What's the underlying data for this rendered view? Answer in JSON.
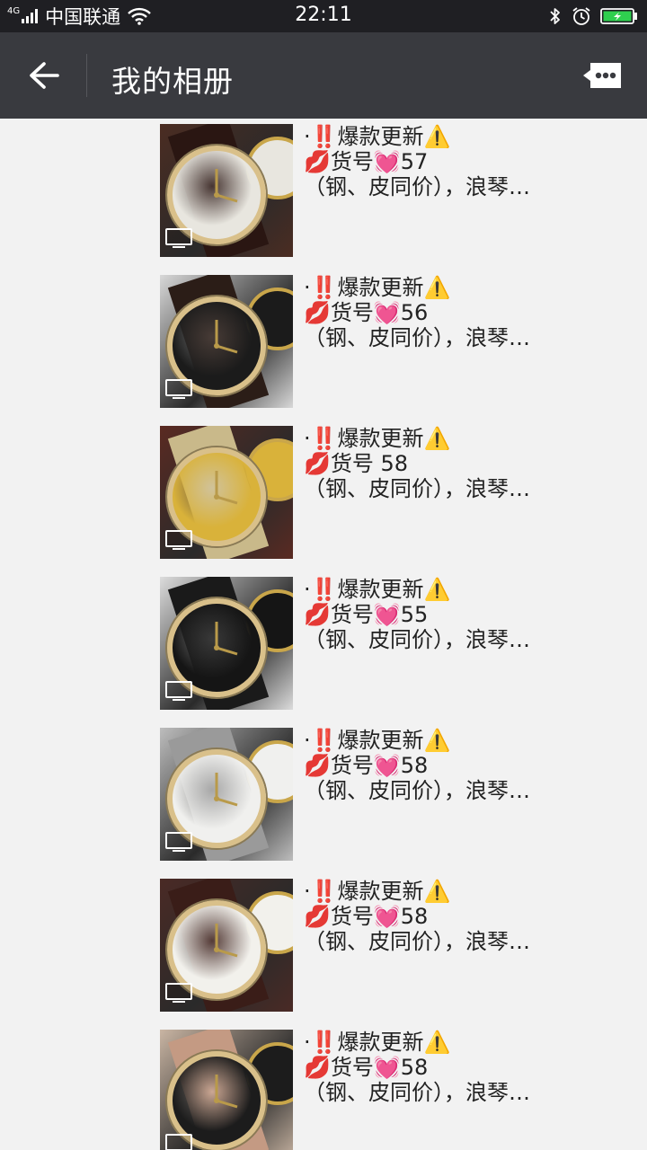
{
  "status_bar": {
    "network": "4G",
    "carrier": "中国联通",
    "time": "22:11"
  },
  "header": {
    "title": "我的相册",
    "back_icon": "arrow-left-icon",
    "more_icon": "more-comment-icon"
  },
  "colors": {
    "status_bar_bg": "#1f1f23",
    "header_bg": "#393a3f",
    "page_bg": "#f2f2f2",
    "battery_fill": "#2fcf4f"
  },
  "posts": [
    {
      "line1": "·‼️爆款更新⚠️",
      "line2": "💋货号💓57",
      "line3": "（钢、皮同价），浪琴…",
      "dial_color": "#e8e6df",
      "bg_color": "#4b2c22",
      "strap_color": "#2a1612"
    },
    {
      "line1": "·‼️爆款更新⚠️",
      "line2": "💋货号💓56",
      "line3": "（钢、皮同价），浪琴…",
      "dial_color": "#1b1b1b",
      "bg_color": "#d8d8d8",
      "strap_color": "#2b1d17"
    },
    {
      "line1": "·‼️爆款更新⚠️",
      "line2": "💋货号 58",
      "line3": "（钢、皮同价），浪琴…",
      "dial_color": "#d9b23a",
      "bg_color": "#5a2a22",
      "strap_color": "#c9b98a"
    },
    {
      "line1": "·‼️爆款更新⚠️",
      "line2": "💋货号💓55",
      "line3": "（钢、皮同价），浪琴…",
      "dial_color": "#151515",
      "bg_color": "#dcdcdc",
      "strap_color": "#1a1a1a"
    },
    {
      "line1": "·‼️爆款更新⚠️",
      "line2": "💋货号💓58",
      "line3": "（钢、皮同价），浪琴…",
      "dial_color": "#f0f0ee",
      "bg_color": "#bdbdbd",
      "strap_color": "#9a9a9a"
    },
    {
      "line1": "·‼️爆款更新⚠️",
      "line2": "💋货号💓58",
      "line3": "（钢、皮同价），浪琴…",
      "dial_color": "#f2f1ec",
      "bg_color": "#4a2a25",
      "strap_color": "#3a1d18"
    },
    {
      "line1": "·‼️爆款更新⚠️",
      "line2": "💋货号💓58",
      "line3": "（钢、皮同价），浪琴…",
      "dial_color": "#1c1c1c",
      "bg_color": "#c9b5a3",
      "strap_color": "#c49a83"
    }
  ]
}
